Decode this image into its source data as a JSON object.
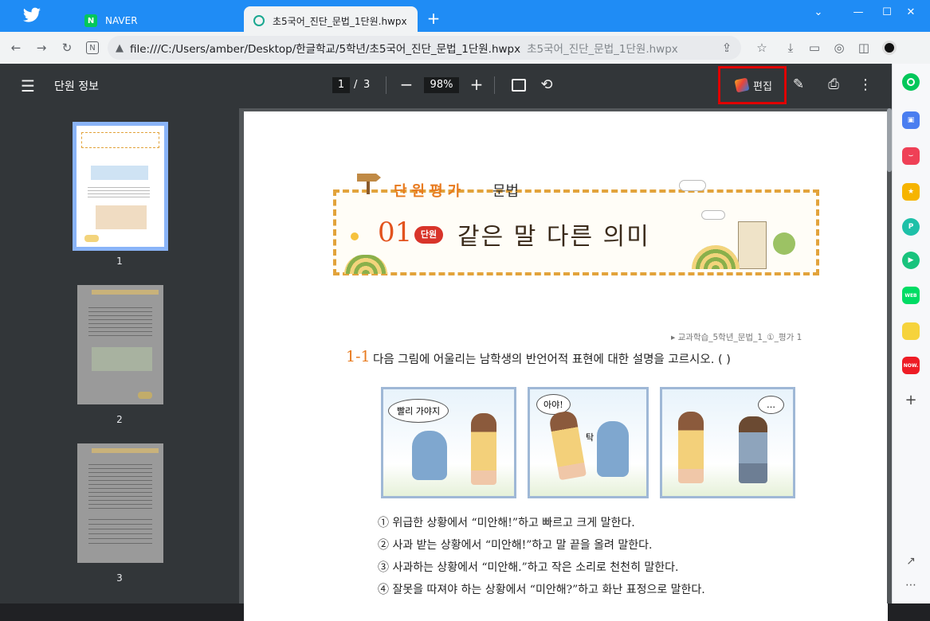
{
  "browser": {
    "tabs": [
      {
        "label": "NAVER",
        "icon": "naver-icon"
      },
      {
        "label": "초5국어_진단_문법_1단원.hwpx",
        "icon": "loading-icon"
      }
    ],
    "new_tab_label": "+",
    "url": "file:///C:/Users/amber/Desktop/한글학교/5학년/초5국어_진단_문법_1단원.hwpx",
    "url_suffix": "초5국어_진단_문법_1단원.hwpx"
  },
  "viewer": {
    "title": "단원 정보",
    "current_page": "1",
    "page_sep": "/",
    "total_pages": "3",
    "zoom": "98%",
    "edit_label": "편집"
  },
  "thumbnails": [
    {
      "label": "1",
      "selected": true
    },
    {
      "label": "2",
      "selected": false
    },
    {
      "label": "3",
      "selected": false
    }
  ],
  "document": {
    "banner_top": "단원평가",
    "banner_subject": "문법",
    "unit_number": "01",
    "unit_badge": "단원",
    "unit_title": "같은 말 다른 의미",
    "source_ref": "▸ 교과학습_5학년_문법_1_①_평가 1",
    "question_num": "1-1",
    "question_text": "다음 그림에 어울리는 남학생의 반언어적 표현에 대한 설명을 고르시오. (        )",
    "bubbles": [
      "빨리 가야지",
      "아야!",
      "…"
    ],
    "bump_label": "탁",
    "options": [
      "① 위급한 상황에서 “미안해!”하고 빠르고 크게 말한다.",
      "② 사과 받는 상황에서 “미안해!”하고 말 끝을 올려 말한다.",
      "③ 사과하는 상황에서 “미안해.”하고 작은 소리로 천천히 말한다.",
      "④ 잘못을 따져야 하는 상황에서 “미안해?”하고 화난 표정으로 말한다."
    ]
  },
  "colors": {
    "titlebar": "#1f8cf5",
    "highlight": "#e00000",
    "accent_orange": "#e87a1e"
  }
}
